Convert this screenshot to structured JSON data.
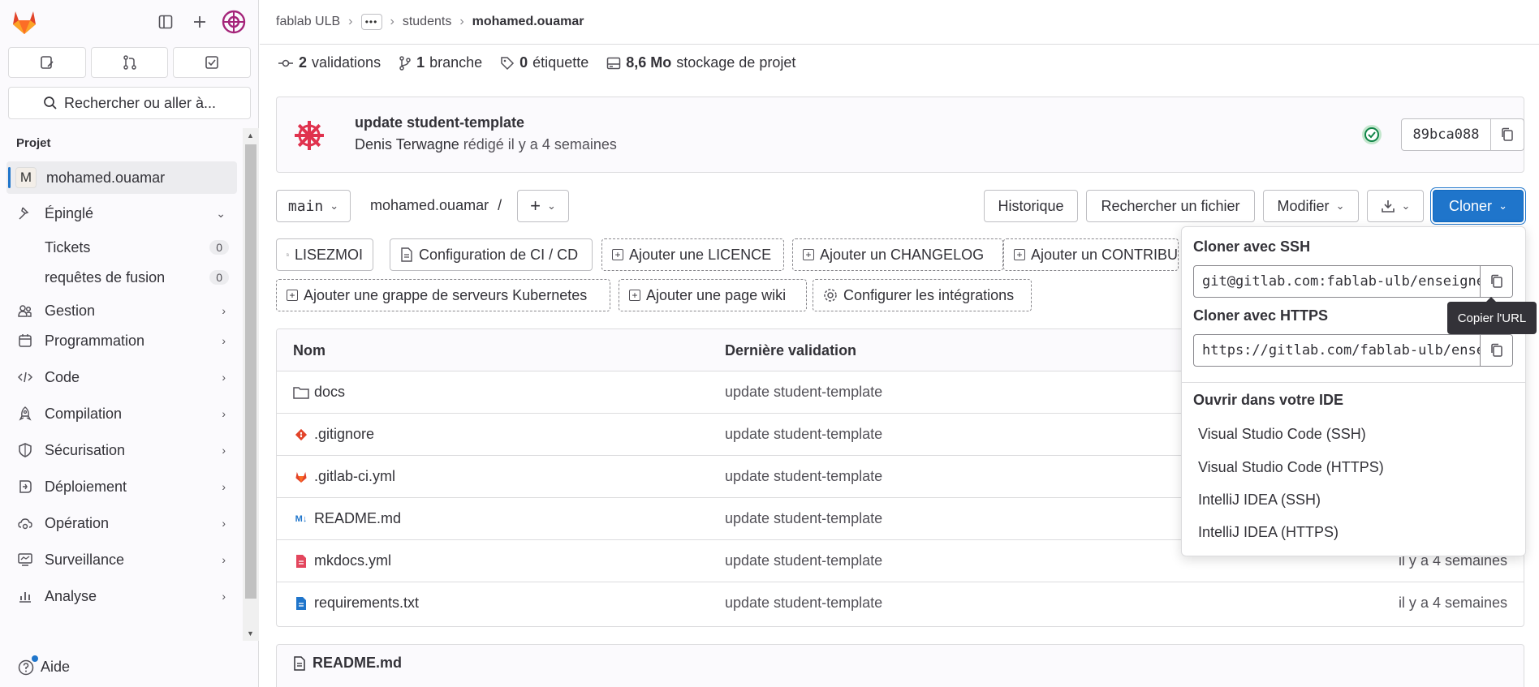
{
  "sidebar": {
    "search_label": "Rechercher ou aller à...",
    "section": "Projet",
    "project_initial": "M",
    "project_name": "mohamed.ouamar",
    "pinned": "Épinglé",
    "pinned_items": [
      {
        "label": "Tickets",
        "count": "0"
      },
      {
        "label": "requêtes de fusion",
        "count": "0"
      }
    ],
    "nav": [
      {
        "label": "Gestion",
        "icon": "users-icon"
      },
      {
        "label": "Programmation",
        "icon": "calendar-icon"
      },
      {
        "label": "Code",
        "icon": "code-icon"
      },
      {
        "label": "Compilation",
        "icon": "rocket-icon"
      },
      {
        "label": "Sécurisation",
        "icon": "shield-icon"
      },
      {
        "label": "Déploiement",
        "icon": "deployments-icon"
      },
      {
        "label": "Opération",
        "icon": "cloud-gear-icon"
      },
      {
        "label": "Surveillance",
        "icon": "monitor-icon"
      },
      {
        "label": "Analyse",
        "icon": "chart-icon"
      }
    ],
    "help": "Aide"
  },
  "breadcrumb": {
    "items": [
      "fablab ULB",
      "students",
      "mohamed.ouamar"
    ]
  },
  "stats": {
    "commits_count": "2",
    "commits_label": "validations",
    "branches_count": "1",
    "branches_label": "branche",
    "tags_count": "0",
    "tags_label": "étiquette",
    "storage_size": "8,6 Mo",
    "storage_label": "stockage de projet"
  },
  "commit": {
    "title": "update student-template",
    "author": "Denis Terwagne",
    "meta": "rédigé il y a 4 semaines",
    "sha": "89bca088"
  },
  "toolbar": {
    "branch": "main",
    "path": "mohamed.ouamar",
    "path_sep": "/",
    "history": "Historique",
    "find_file": "Rechercher un fichier",
    "edit": "Modifier",
    "clone": "Cloner"
  },
  "shortcuts": [
    "LISEZMOI",
    "Configuration de CI / CD",
    "Ajouter une LICENCE",
    "Ajouter un CHANGELOG",
    "Ajouter un CONTRIBUTING",
    "Ajouter une grappe de serveurs Kubernetes",
    "Ajouter une page wiki",
    "Configurer les intégrations"
  ],
  "table": {
    "col_name": "Nom",
    "col_commit": "Dernière validation",
    "rows": [
      {
        "name": "docs",
        "icon": "folder-icon",
        "commit": "update student-template",
        "date": ""
      },
      {
        "name": ".gitignore",
        "icon": "git-icon",
        "commit": "update student-template",
        "date": ""
      },
      {
        "name": ".gitlab-ci.yml",
        "icon": "gitlab-icon",
        "commit": "update student-template",
        "date": ""
      },
      {
        "name": "README.md",
        "icon": "markdown-icon",
        "commit": "update student-template",
        "date": ""
      },
      {
        "name": "mkdocs.yml",
        "icon": "yaml-icon",
        "commit": "update student-template",
        "date": "il y a 4 semaines"
      },
      {
        "name": "requirements.txt",
        "icon": "text-file-icon",
        "commit": "update student-template",
        "date": "il y a 4 semaines"
      }
    ]
  },
  "readme": {
    "title": "README.md"
  },
  "clone_dropdown": {
    "ssh_heading": "Cloner avec SSH",
    "ssh_url": "git@gitlab.com:fablab-ulb/enseignements",
    "https_heading": "Cloner avec HTTPS",
    "https_url": "https://gitlab.com/fablab-ulb/enseignements",
    "ide_heading": "Ouvrir dans votre IDE",
    "ide_options": [
      "Visual Studio Code (SSH)",
      "Visual Studio Code (HTTPS)",
      "IntelliJ IDEA (SSH)",
      "IntelliJ IDEA (HTTPS)"
    ],
    "tooltip": "Copier l'URL"
  },
  "colors": {
    "primary": "#1f75cb",
    "success": "#108548",
    "gitlab_orange": "#e24329"
  }
}
